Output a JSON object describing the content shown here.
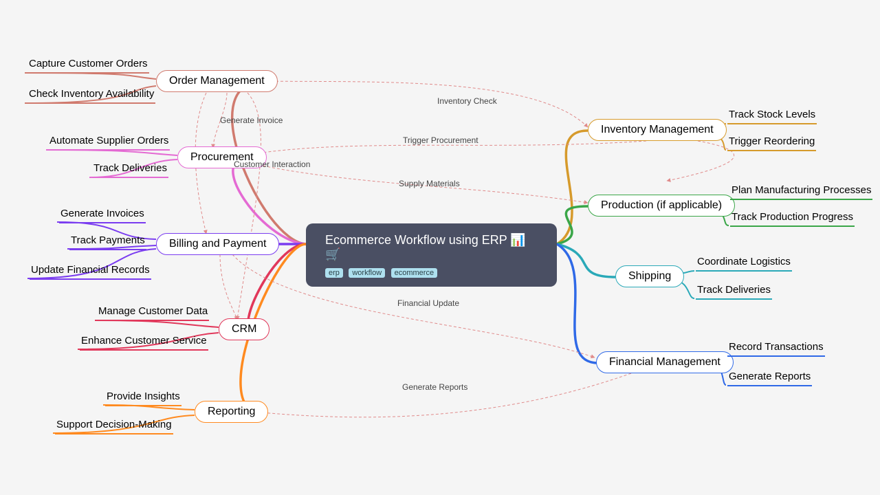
{
  "root": {
    "title": "Ecommerce Workflow using ERP 📊🛒",
    "tags": [
      "erp",
      "workflow",
      "ecommerce"
    ]
  },
  "left": [
    {
      "name": "Order Management",
      "color": "#d07a6e",
      "children": [
        "Capture Customer Orders",
        "Check Inventory Availability"
      ]
    },
    {
      "name": "Procurement",
      "color": "#e46ad3",
      "children": [
        "Automate Supplier Orders",
        "Track Deliveries"
      ]
    },
    {
      "name": "Billing and Payment",
      "color": "#7a3cf0",
      "children": [
        "Generate Invoices",
        "Track Payments",
        "Update Financial Records"
      ]
    },
    {
      "name": "CRM",
      "color": "#e1375a",
      "children": [
        "Manage Customer Data",
        "Enhance Customer Service"
      ]
    },
    {
      "name": "Reporting",
      "color": "#ff8a1f",
      "children": [
        "Provide Insights",
        "Support Decision-Making"
      ]
    }
  ],
  "right": [
    {
      "name": "Inventory Management",
      "color": "#d69a2b",
      "children": [
        "Track Stock Levels",
        "Trigger Reordering"
      ]
    },
    {
      "name": "Production (if applicable)",
      "color": "#3aa648",
      "children": [
        "Plan Manufacturing Processes",
        "Track Production Progress"
      ]
    },
    {
      "name": "Shipping",
      "color": "#2aa9b8",
      "children": [
        "Coordinate Logistics",
        "Track Deliveries"
      ]
    },
    {
      "name": "Financial Management",
      "color": "#2f69e7",
      "children": [
        "Record Transactions",
        "Generate Reports"
      ]
    }
  ],
  "edge_labels": [
    "Inventory Check",
    "Trigger Procurement",
    "Customer Interaction",
    "Supply Materials",
    "Financial Update",
    "Generate Reports",
    "Generate Invoice"
  ]
}
